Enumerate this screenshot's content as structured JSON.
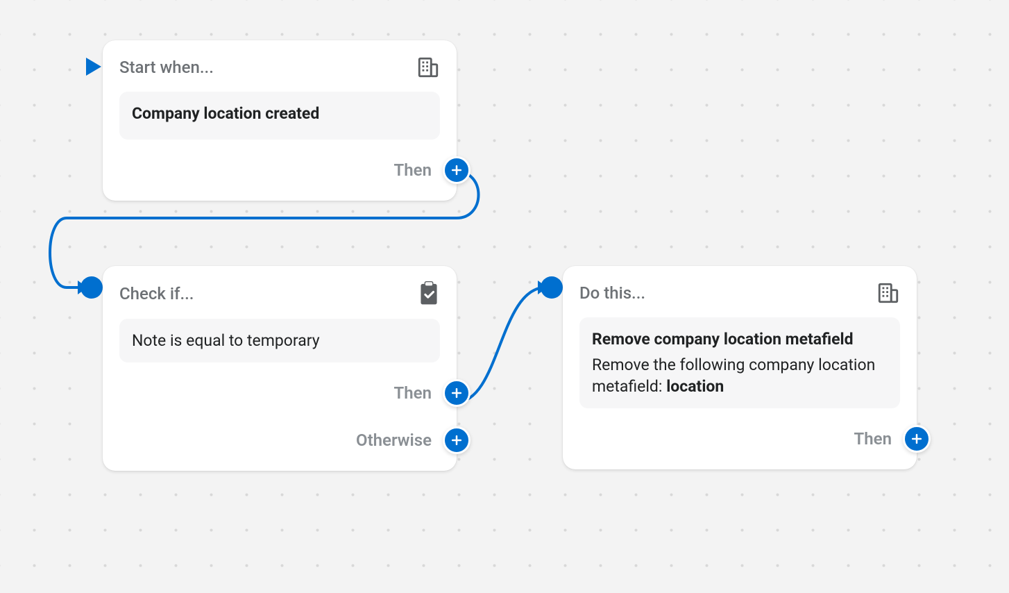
{
  "colors": {
    "accent": "#006fcf",
    "card_bg": "#ffffff",
    "canvas_bg": "#f3f3f3"
  },
  "labels": {
    "then": "Then",
    "otherwise": "Otherwise"
  },
  "nodes": {
    "start": {
      "header": "Start when...",
      "body_title": "Company location created",
      "icon": "building-icon"
    },
    "check": {
      "header": "Check if...",
      "body_text": "Note is equal to temporary",
      "icon": "clipboard-check-icon"
    },
    "action": {
      "header": "Do this...",
      "body_title": "Remove company location metafield",
      "body_subtitle_prefix": "Remove the following company location metafield: ",
      "body_subtitle_bold": "location",
      "icon": "building-icon"
    }
  }
}
